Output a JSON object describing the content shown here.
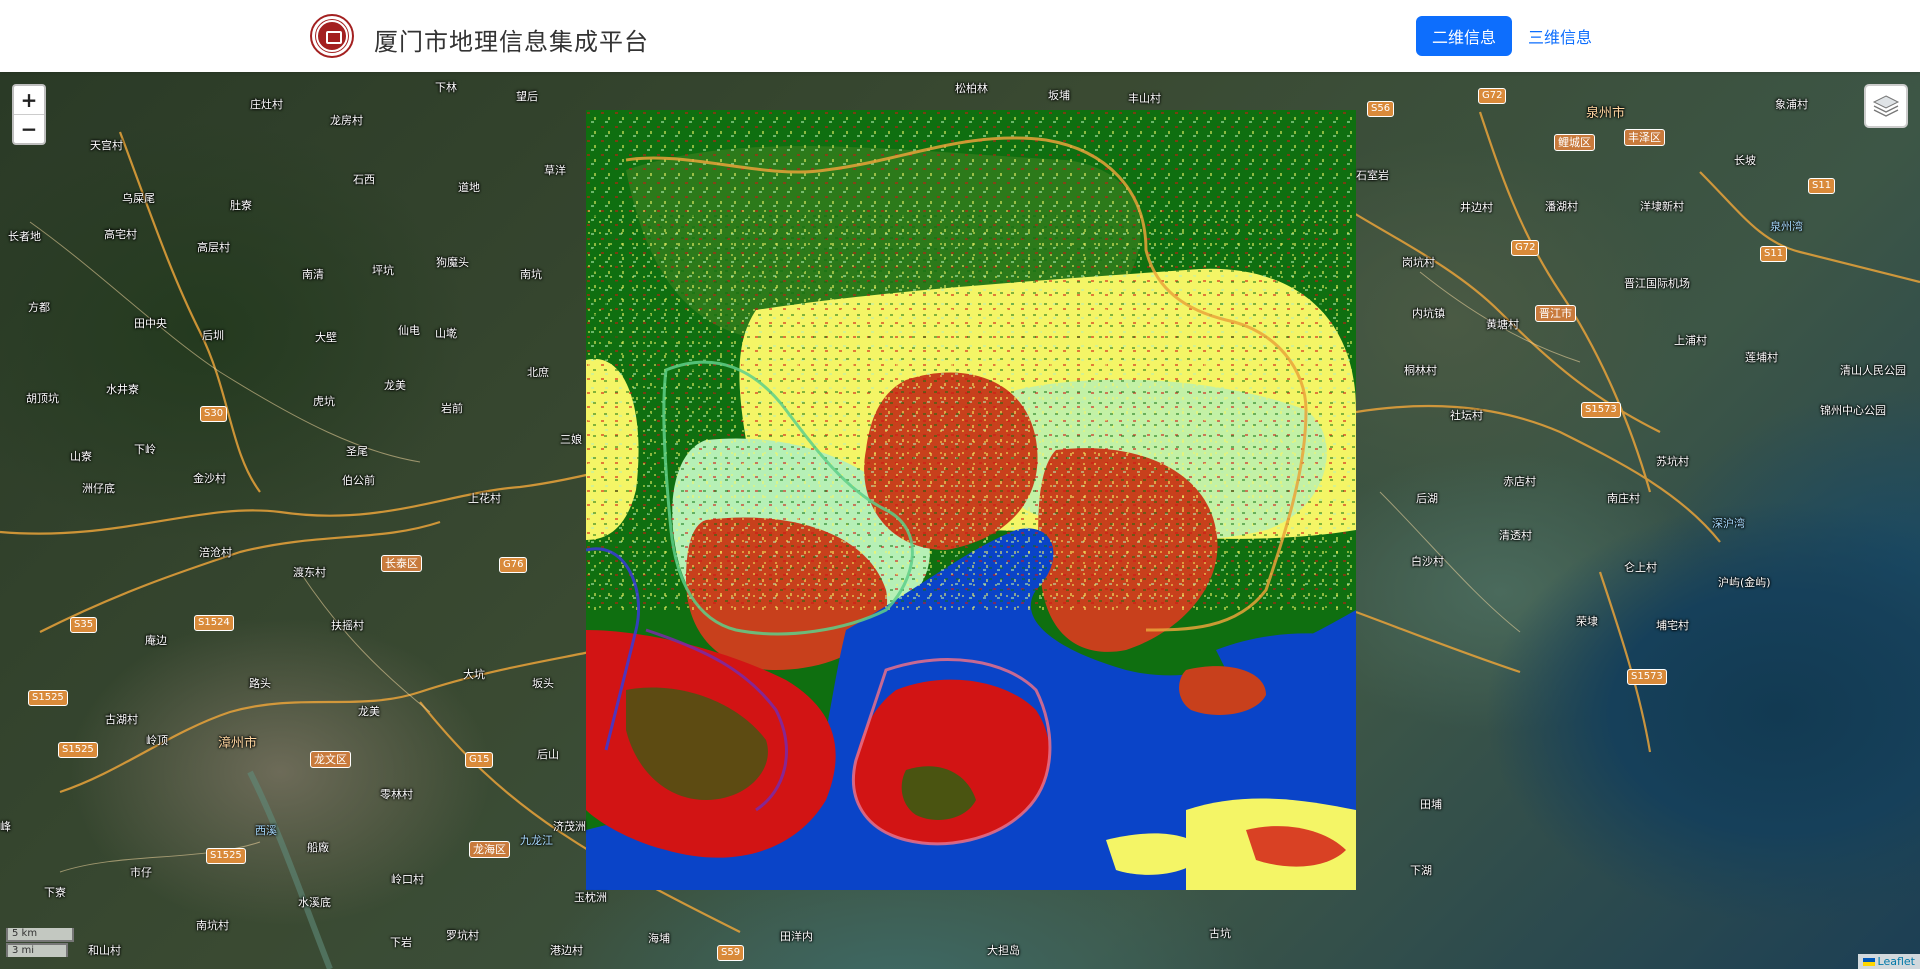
{
  "header": {
    "title": "厦门市地理信息集成平台",
    "buttons": {
      "two_d": "二维信息",
      "three_d": "三维信息"
    }
  },
  "map": {
    "zoom_in": "+",
    "zoom_out": "−",
    "scale": {
      "km": "5 km",
      "mi": "3 mi"
    },
    "attribution": "Leaflet",
    "layers_icon": "layers-icon",
    "places": [
      "庄灶村",
      "龙房村",
      "下林",
      "望后",
      "松柏林",
      "坂埔",
      "丰山村",
      "天宫村",
      "乌屎尾",
      "肚寮",
      "石西",
      "道地",
      "草洋",
      "长者地",
      "高宅村",
      "高层村",
      "南清",
      "坪坑",
      "狗魔头",
      "南坑",
      "方都",
      "田中央",
      "后圳",
      "大壁",
      "仙电",
      "山墘",
      "北庶",
      "胡顶坑",
      "水井寮",
      "虎坑",
      "龙美",
      "岩前",
      "三娘",
      "山寮",
      "下岭",
      "圣尾",
      "洲仔底",
      "金沙村",
      "伯公前",
      "上花村",
      "涪沧村",
      "渡东村",
      "庵边",
      "扶摇村",
      "路头",
      "大坑",
      "坂头",
      "古湖村",
      "岭顶",
      "龙美",
      "后山",
      "零林村",
      "船廠",
      "下寮",
      "市仔",
      "水溪底",
      "岭口村",
      "南坑村",
      "和山村",
      "下岩",
      "罗坑村",
      "港边村",
      "海埔",
      "田洋内",
      "大担岛",
      "古坑",
      "玉枕洲",
      "济茂洲",
      "石室岩",
      "井边村",
      "潘湖村",
      "洋埭新村",
      "长坡",
      "象浦村",
      "岗坑村",
      "内坑镇",
      "黄塘村",
      "上浦村",
      "桐林村",
      "莲埔村",
      "社坛村",
      "苏坑村",
      "后湖",
      "赤店村",
      "南庄村",
      "清透村",
      "白沙村",
      "仑上村",
      "沪屿(金屿)",
      "荣埭",
      "埔宅村",
      "田埔",
      "下湖",
      "峰",
      "晋江国际机场",
      "清山人民公园",
      "锦州中心公园"
    ],
    "water_labels": [
      "泉州湾",
      "深沪湾",
      "西溪",
      "九龙江"
    ],
    "badges": [
      "S30",
      "S35",
      "S1524",
      "S1525",
      "S1525",
      "S1525",
      "G76",
      "G15",
      "S59",
      "S56",
      "G72",
      "G72",
      "S11",
      "S11",
      "S1573",
      "S1573"
    ],
    "districts": [
      "长泰区",
      "漳州市",
      "龙文区",
      "龙海区",
      "泉州市",
      "鲤城区",
      "丰泽区",
      "晋江市"
    ],
    "colors": {
      "forest": "#0f6f10",
      "grass": "#2c7a1a",
      "crop": "#f4f566",
      "built": "#c8401c",
      "red": "#d21414",
      "bare": "#b6f0b6",
      "water": "#0a44c8",
      "wetland": "#8fd8c8"
    }
  }
}
